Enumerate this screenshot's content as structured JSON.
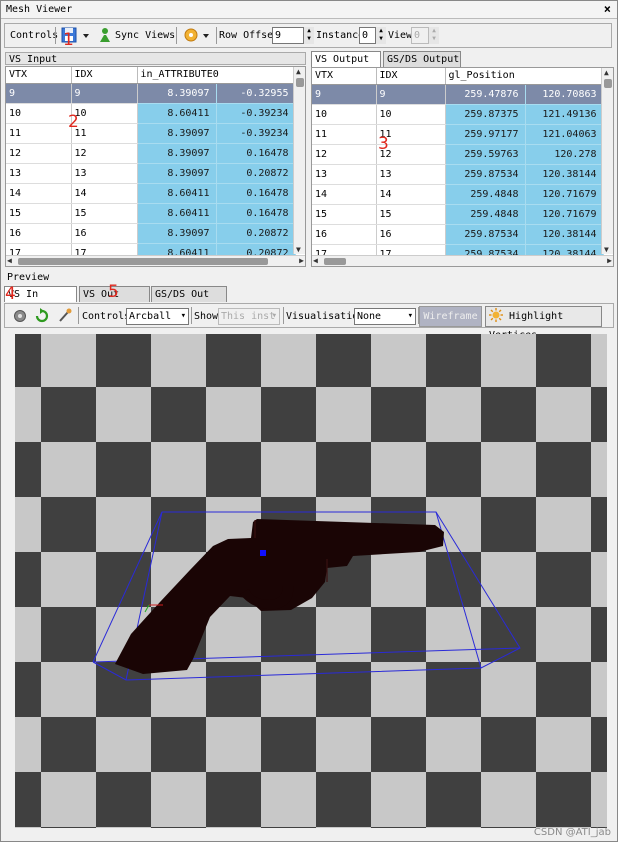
{
  "window": {
    "title": "Mesh Viewer",
    "close": "×"
  },
  "toolbar": {
    "controls_label": "Controls",
    "sync_views": "Sync Views",
    "row_offset_label": "Row Offset",
    "row_offset_value": "9",
    "instance_label": "Instance",
    "instance_value": "0",
    "view_label": "View",
    "view_value": "0"
  },
  "vs_input": {
    "header": "VS Input",
    "columns": [
      "VTX",
      "IDX",
      "in_ATTRIBUTE0"
    ],
    "rows": [
      [
        "9",
        "9",
        "8.39097",
        "-0.32955"
      ],
      [
        "10",
        "10",
        "8.60411",
        "-0.39234"
      ],
      [
        "11",
        "11",
        "8.39097",
        "-0.39234"
      ],
      [
        "12",
        "12",
        "8.39097",
        "0.16478"
      ],
      [
        "13",
        "13",
        "8.39097",
        "0.20872"
      ],
      [
        "14",
        "14",
        "8.60411",
        "0.16478"
      ],
      [
        "15",
        "15",
        "8.60411",
        "0.16478"
      ],
      [
        "16",
        "16",
        "8.39097",
        "0.20872"
      ],
      [
        "17",
        "17",
        "8.60411",
        "0.20872"
      ]
    ]
  },
  "vs_output": {
    "tabs": [
      "VS Output",
      "GS/DS Output"
    ],
    "columns": [
      "VTX",
      "IDX",
      "gl_Position"
    ],
    "rows": [
      [
        "9",
        "9",
        "259.47876",
        "120.70863"
      ],
      [
        "10",
        "10",
        "259.87375",
        "121.49136"
      ],
      [
        "11",
        "11",
        "259.97177",
        "121.04063"
      ],
      [
        "12",
        "12",
        "259.59763",
        "120.278"
      ],
      [
        "13",
        "13",
        "259.87534",
        "120.38144"
      ],
      [
        "14",
        "14",
        "259.4848",
        "120.71679"
      ],
      [
        "15",
        "15",
        "259.4848",
        "120.71679"
      ],
      [
        "16",
        "16",
        "259.87534",
        "120.38144"
      ],
      [
        "17",
        "17",
        "259.87534",
        "120.38144"
      ]
    ]
  },
  "preview": {
    "header": "Preview",
    "tabs": [
      "VS In",
      "VS Out",
      "GS/DS Out"
    ],
    "controls_label": "Controls",
    "controls_value": "Arcball",
    "show_label": "Show",
    "show_value": "This inst",
    "visualisation_label": "Visualisation",
    "visualisation_value": "None",
    "wireframe": "Wireframe",
    "highlight": "Highlight Vertices"
  },
  "annotations": [
    "1",
    "2",
    "3",
    "4",
    "5"
  ],
  "watermark": "CSDN @ATI_jab",
  "colors": {
    "selected_row": "#7d8aa8",
    "value_cell": "#87ceeb",
    "wireframe": "#2a2ad8",
    "annotation": "#e0281e"
  }
}
